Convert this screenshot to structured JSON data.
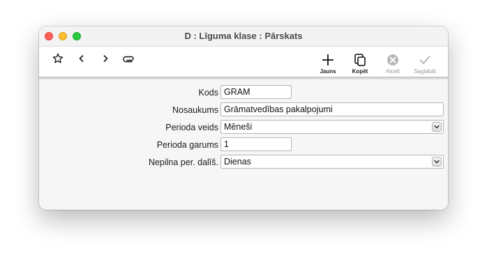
{
  "window": {
    "title": "D : Līguma klase : Pārskats"
  },
  "toolbar": {
    "icons": [
      "star-icon",
      "chevron-left-icon",
      "chevron-right-icon",
      "paperclip-icon"
    ],
    "jauns_label": "Jauns",
    "kopet_label": "Kopēt",
    "atcelt_label": "Atcelt",
    "saglabat_label": "Saglabāt"
  },
  "form": {
    "kods_label": "Kods",
    "kods_value": "GRAM",
    "nosaukums_label": "Nosaukums",
    "nosaukums_value": "Grāmatvedības pakalpojumi",
    "perioda_veids_label": "Perioda veids",
    "perioda_veids_value": "Mēneši",
    "perioda_garums_label": "Perioda garums",
    "perioda_garums_value": "1",
    "nepilna_label": "Nepilna per. dalīš.",
    "nepilna_value": "Dienas"
  },
  "colors": {
    "close": "#fe5f57",
    "minimize": "#febc2e",
    "maximize": "#28c840"
  }
}
